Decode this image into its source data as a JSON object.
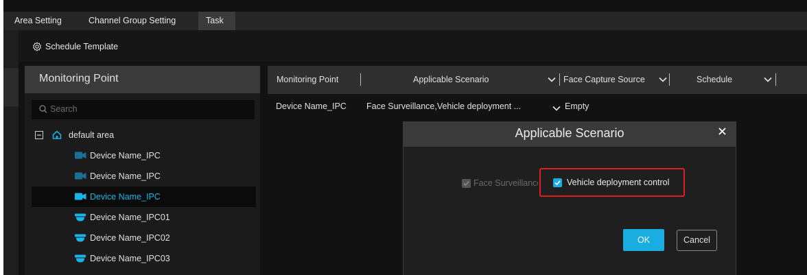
{
  "tabs": [
    {
      "label": "Area Setting",
      "active": false
    },
    {
      "label": "Channel Group Setting",
      "active": false
    },
    {
      "label": "Task",
      "active": true
    }
  ],
  "toolbar": {
    "schedule_template_label": "Schedule Template",
    "icon": "gear-icon"
  },
  "monitoring_panel": {
    "title": "Monitoring Point",
    "search_placeholder": "Search",
    "tree": {
      "area": {
        "label": "default area",
        "expanded": true,
        "icon": "home-icon"
      },
      "devices": [
        {
          "label": "Device Name_IPC",
          "icon": "box-camera-icon",
          "selected": false
        },
        {
          "label": "Device Name_IPC",
          "icon": "box-camera-icon",
          "selected": false
        },
        {
          "label": "Device Name_IPC",
          "icon": "box-camera-icon",
          "selected": true
        },
        {
          "label": "Device Name_IPC01",
          "icon": "dome-camera-icon",
          "selected": false
        },
        {
          "label": "Device Name_IPC02",
          "icon": "dome-camera-icon",
          "selected": false
        },
        {
          "label": "Device Name_IPC03",
          "icon": "dome-camera-icon",
          "selected": false
        }
      ]
    }
  },
  "table": {
    "headers": {
      "monitoring_point": "Monitoring Point",
      "applicable_scenario": "Applicable Scenario",
      "face_capture_source": "Face Capture Source",
      "schedule": "Schedule"
    },
    "rows": [
      {
        "monitoring_point": "Device Name_IPC",
        "applicable_scenario": "Face Surveillance,Vehicle deployment ...",
        "face_capture_source": "Empty"
      }
    ]
  },
  "dialog": {
    "title": "Applicable Scenario",
    "options": [
      {
        "label": "Face Surveillance",
        "checked": true,
        "disabled": true
      },
      {
        "label": "Vehicle deployment control",
        "checked": true,
        "disabled": false
      }
    ],
    "ok_label": "OK",
    "cancel_label": "Cancel"
  },
  "colors": {
    "accent": "#1AADDF",
    "selected_text": "#18B6E8",
    "highlight_border": "#E02020"
  }
}
